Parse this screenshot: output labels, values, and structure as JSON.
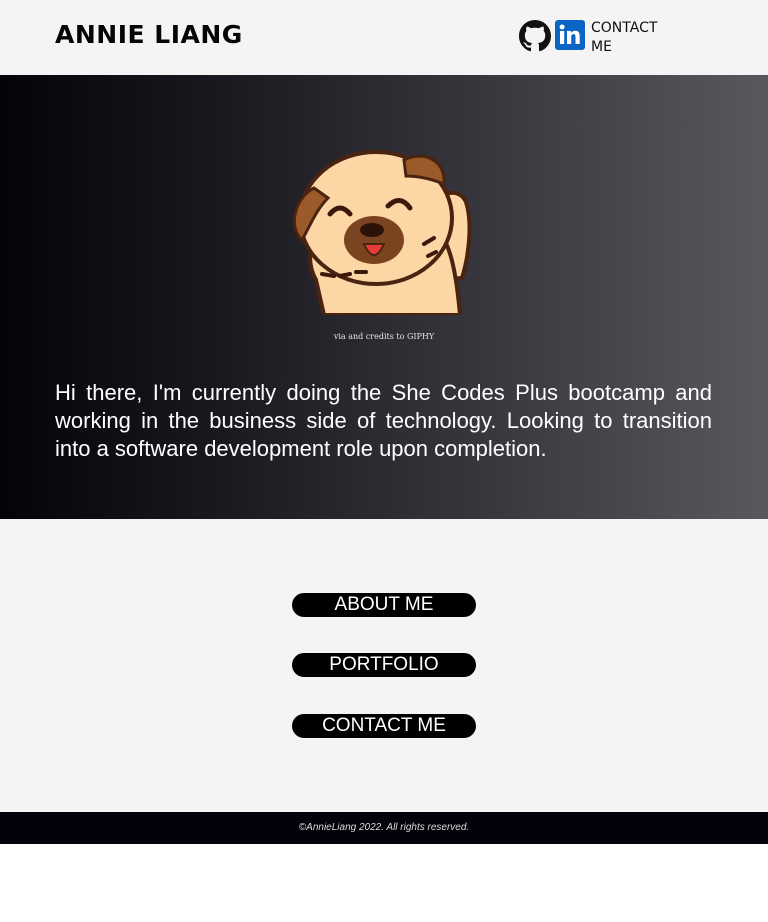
{
  "header": {
    "brand": "ANNIE LIANG",
    "github_icon": "github-icon",
    "linkedin_icon": "linkedin-icon",
    "contact_link": "CONTACT ME"
  },
  "hero": {
    "gif_subject": "pug-waving",
    "credit": "via and credits to GIPHY",
    "bio": "Hi there, I'm currently doing the She Codes Plus bootcamp and working in the business side of technology. Looking to transition into a software development role upon completion."
  },
  "nav": {
    "about": "ABOUT ME",
    "portfolio": "PORTFOLIO",
    "contact": "CONTACT ME"
  },
  "footer": {
    "copyright": "©AnnieLiang 2022. All rights reserved."
  },
  "colors": {
    "header_bg": "#f4f4f4",
    "hero_gradient_start": "#050308",
    "hero_gradient_end": "#58585e",
    "button_bg": "#000000",
    "footer_bg": "#02020a",
    "linkedin_blue": "#0a66c2"
  }
}
